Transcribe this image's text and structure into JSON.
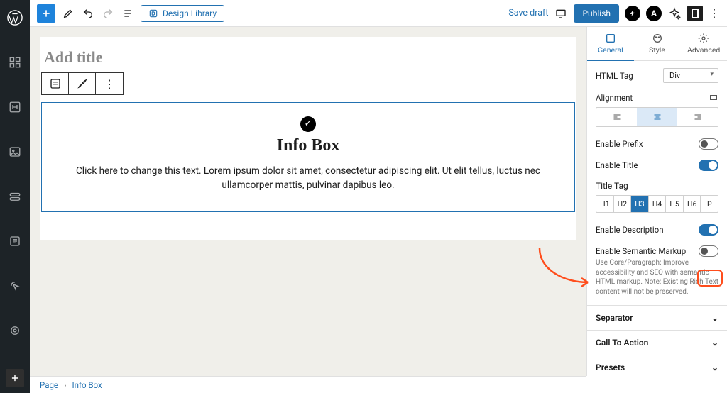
{
  "topbar": {
    "design_library": "Design Library",
    "save_draft": "Save draft",
    "publish": "Publish"
  },
  "canvas": {
    "add_title_placeholder": "Add title",
    "infobox": {
      "heading": "Info Box",
      "body": "Click here to change this text. Lorem ipsum dolor sit amet, consectetur adipiscing elit. Ut elit tellus, luctus nec ullamcorper mattis, pulvinar dapibus leo."
    }
  },
  "panel": {
    "tabs": {
      "general": "General",
      "style": "Style",
      "advanced": "Advanced"
    },
    "html_tag_label": "HTML Tag",
    "html_tag_value": "Div",
    "alignment_label": "Alignment",
    "enable_prefix": "Enable Prefix",
    "enable_title": "Enable Title",
    "title_tag_label": "Title Tag",
    "title_tags": [
      "H1",
      "H2",
      "H3",
      "H4",
      "H5",
      "H6",
      "P"
    ],
    "title_tag_selected": "H3",
    "enable_description": "Enable Description",
    "enable_semantic": "Enable Semantic Markup",
    "semantic_help": "Use Core/Paragraph: Improve accessibility and SEO with semantic HTML markup. Note: Existing Rich Text content will not be preserved.",
    "acc_separator": "Separator",
    "acc_cta": "Call To Action",
    "acc_presets": "Presets"
  },
  "breadcrumb": {
    "root": "Page",
    "current": "Info Box"
  }
}
